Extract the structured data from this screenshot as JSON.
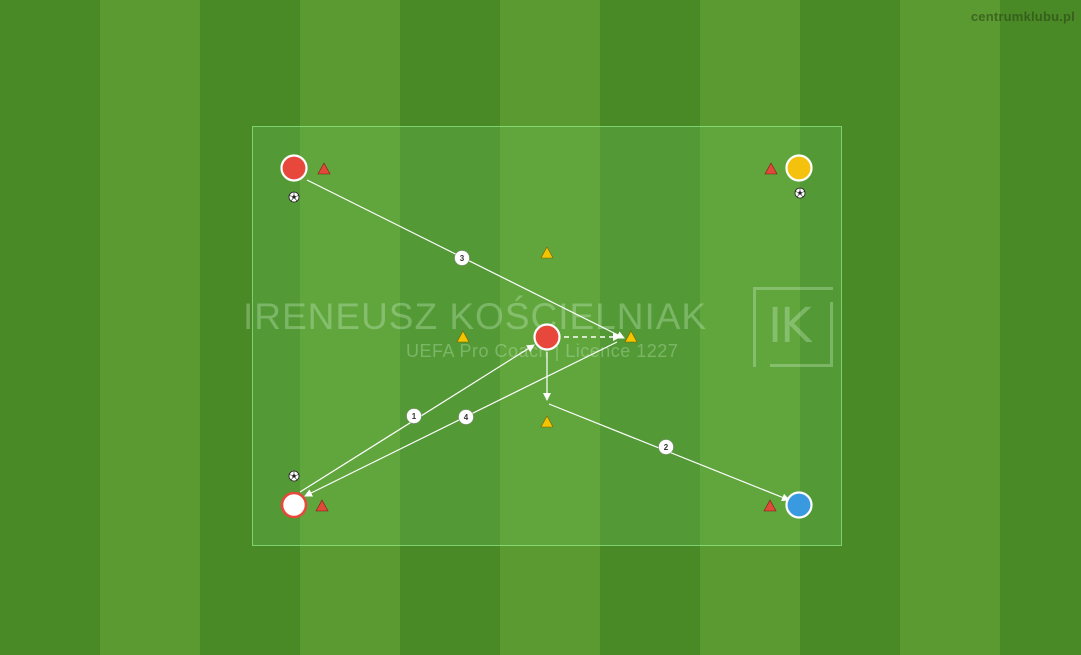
{
  "watermark": {
    "site": "centrumklubu.pl",
    "coach_name": "IRENEUSZ KOŚCIELNIAK",
    "coach_subtitle": "UEFA Pro Coach  |  Licence 1227",
    "logo": "IK"
  },
  "colors": {
    "red_player": "#e8483c",
    "yellow_player": "#f4c20d",
    "blue_player": "#3a9ae0",
    "white_player": "#ffffff",
    "red_cone": "#e04a3a",
    "yellow_cone": "#f2c500"
  },
  "players": [
    {
      "id": "p-top-left",
      "color": "red"
    },
    {
      "id": "p-top-right",
      "color": "yellow"
    },
    {
      "id": "p-center",
      "color": "red"
    },
    {
      "id": "p-bottom-left",
      "color": "white"
    },
    {
      "id": "p-bottom-right",
      "color": "blue"
    }
  ],
  "pass_labels": [
    "1",
    "2",
    "3",
    "4"
  ],
  "icons": [
    "ball-icon",
    "cone-icon"
  ]
}
